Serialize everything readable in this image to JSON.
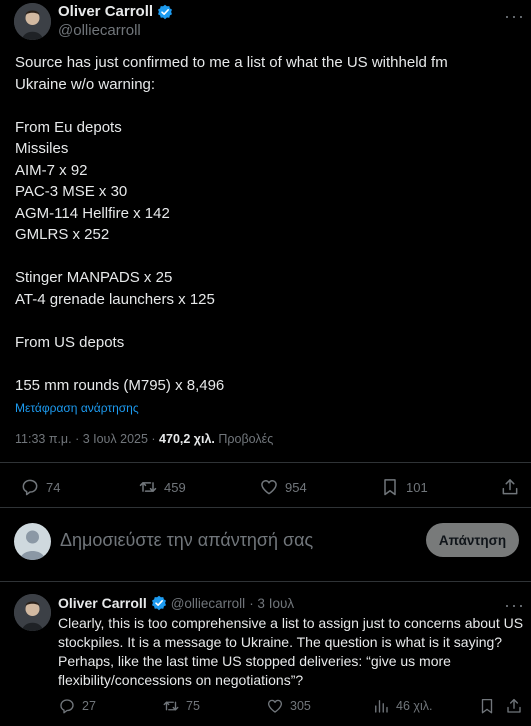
{
  "tweet": {
    "author_name": "Oliver Carroll",
    "handle": "@olliecarroll",
    "lines": [
      "Source has just confirmed to me a list of what the US withheld fm",
      "Ukraine w/o warning:",
      "",
      "From Eu depots",
      "Missiles",
      "AIM-7 x 92",
      "PAC-3 MSE x 30",
      "AGM-114 Hellfire x 142",
      "GMLRS x 252",
      "",
      "Stinger MANPADS x 25",
      "AT-4 grenade launchers x 125",
      "",
      "From US depots",
      "",
      "155 mm rounds (M795) x 8,496"
    ],
    "translate_label": "Μετάφραση ανάρτησης",
    "timestamp": "11:33 π.μ. · 3 Ιουλ 2025 ·",
    "views_count": "470,2 χιλ.",
    "views_label": "Προβολές",
    "actions": {
      "replies": "74",
      "reposts": "459",
      "likes": "954",
      "bookmarks": "101"
    }
  },
  "composer": {
    "placeholder": "Δημοσιεύστε την απάντησή σας",
    "reply_button": "Απάντηση"
  },
  "reply": {
    "author_name": "Oliver Carroll",
    "handle": "@olliecarroll",
    "date": "· 3 Ιουλ",
    "lines": [
      "Clearly, this is too comprehensive a list to assign just to concerns about US",
      "stockpiles. It is a message to Ukraine. The question is what is it saying?",
      "Perhaps, like the last time US stopped deliveries: “give us more",
      "flexibility/concessions on negotiations”?"
    ],
    "actions": {
      "replies": "27",
      "reposts": "75",
      "likes": "305",
      "views": "46 χιλ."
    }
  },
  "colors": {
    "background": "#000000",
    "text": "#e7e9ea",
    "muted": "#71767b",
    "accent": "#1d9bf0",
    "divider": "#2f3336"
  }
}
